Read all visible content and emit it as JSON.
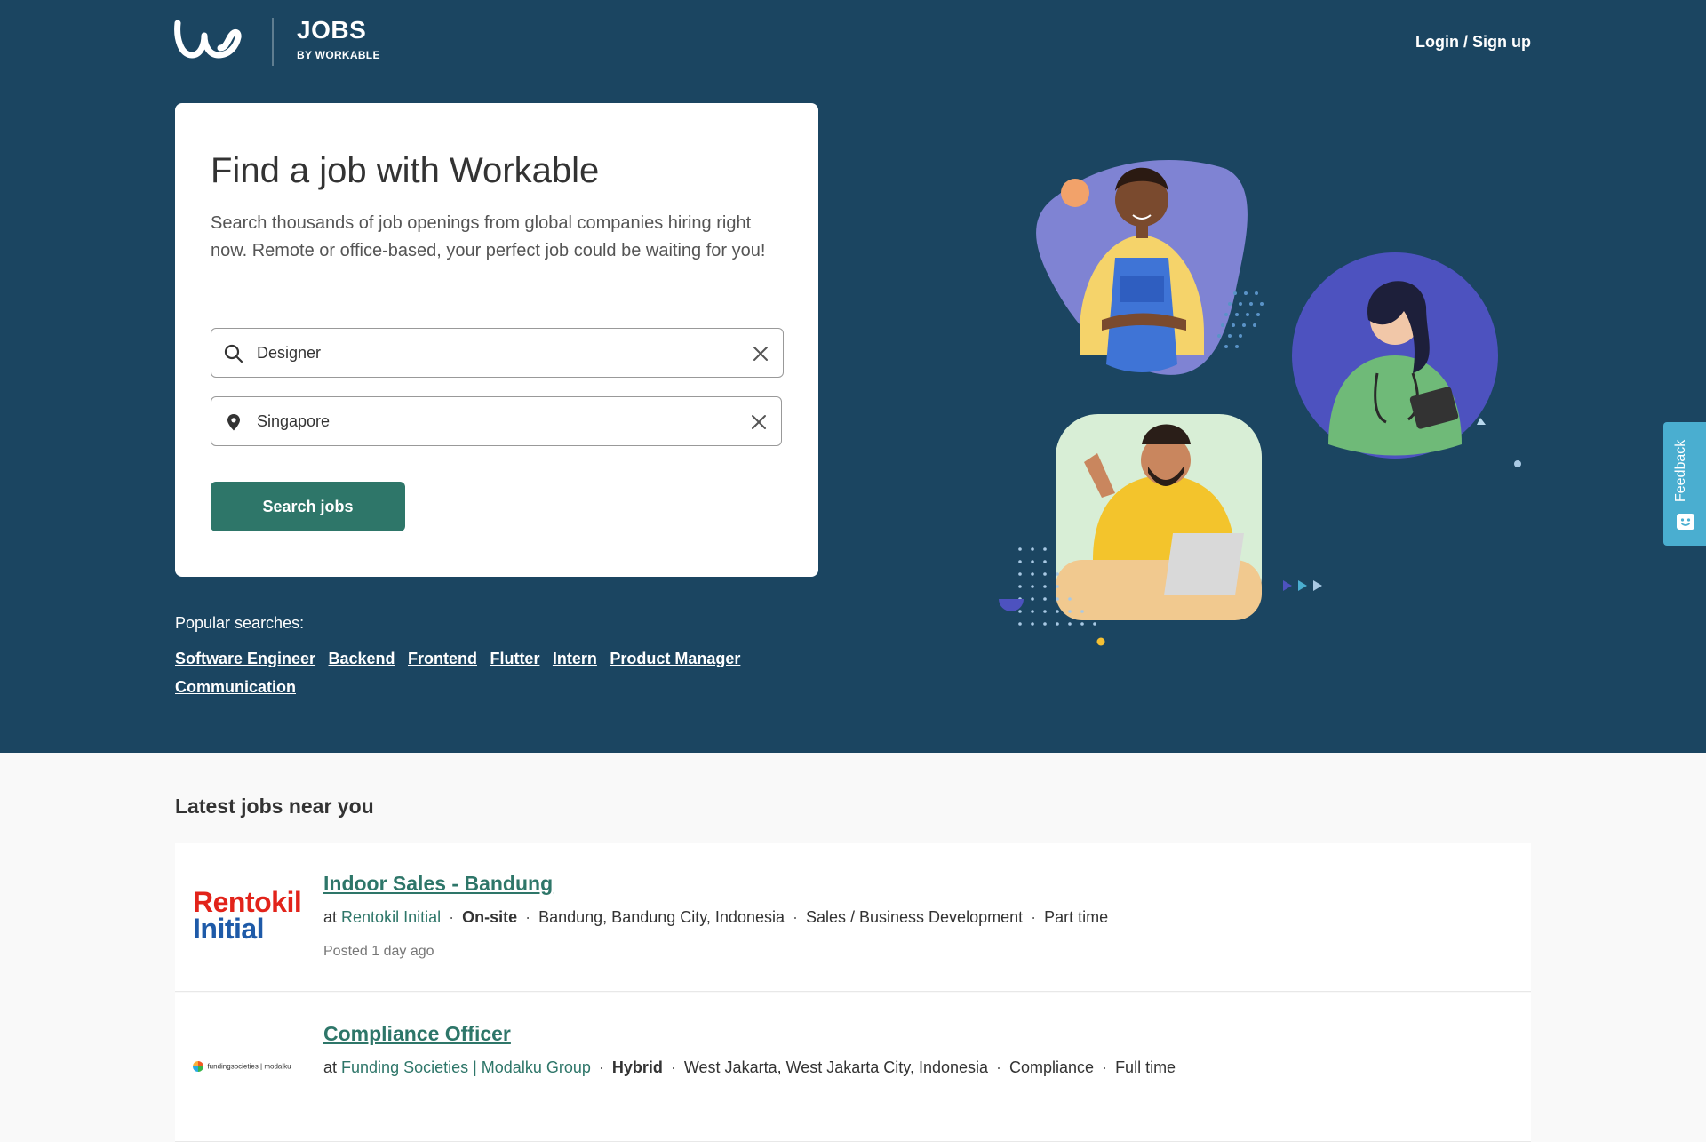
{
  "header": {
    "brand_jobs": "JOBS",
    "brand_by": "BY WORKABLE",
    "login_label": "Login / Sign up"
  },
  "search": {
    "title": "Find a job with Workable",
    "description": "Search thousands of job openings from global companies hiring right now. Remote or office-based, your perfect job could be waiting for you!",
    "keyword_value": "Designer",
    "location_value": "Singapore",
    "button_label": "Search jobs"
  },
  "popular": {
    "label": "Popular searches:",
    "links": [
      "Software Engineer",
      "Backend",
      "Frontend",
      "Flutter",
      "Intern",
      "Product Manager",
      "Communication"
    ]
  },
  "feedback": {
    "label": "Feedback"
  },
  "latest": {
    "title_prefix": "Latest jobs",
    "title_emphasis": "near you",
    "jobs": [
      {
        "title": "Indoor Sales - Bandung",
        "at": "at",
        "company": "Rentokil Initial",
        "workplace": "On-site",
        "location": "Bandung, Bandung City, Indonesia",
        "department": "Sales / Business Development",
        "type": "Part time",
        "posted": "Posted 1 day ago",
        "logo_line1": "Rentokil",
        "logo_line2": "Initial"
      },
      {
        "title": "Compliance Officer",
        "at": "at",
        "company": "Funding Societies | Modalku Group",
        "workplace": "Hybrid",
        "location": "West Jakarta, West Jakarta City, Indonesia",
        "department": "Compliance",
        "type": "Full time",
        "posted": "",
        "logo_text": "fundingsocieties | modalku"
      }
    ]
  },
  "colors": {
    "hero_bg": "#1b4561",
    "primary_green": "#2e7669",
    "feedback_bg": "#4aaed0",
    "rentokil_red": "#e2231a",
    "rentokil_blue": "#1e5aa8"
  },
  "icons": [
    "workable-logo-icon",
    "search-icon",
    "location-pin-icon",
    "close-icon",
    "feedback-smile-icon"
  ]
}
